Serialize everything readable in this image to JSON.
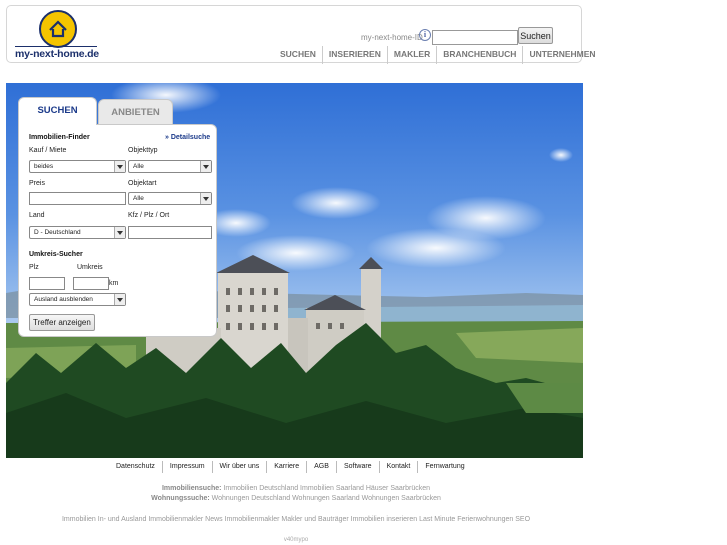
{
  "header": {
    "logo_text": "my-next-home.de",
    "id_label": "my-next-home-ID",
    "info_glyph": "i",
    "search_button": "Suchen",
    "nav": [
      "SUCHEN",
      "INSERIEREN",
      "MAKLER",
      "BRANCHENBUCH",
      "UNTERNEHMEN"
    ]
  },
  "panel": {
    "tabs": {
      "active": "SUCHEN",
      "inactive": "ANBIETEN"
    },
    "finder_title": "Immobilien-Finder",
    "detail_link": "» Detailsuche",
    "kauf_label": "Kauf / Miete",
    "kauf_value": "beides",
    "objekttyp_label": "Objekttyp",
    "objekttyp_value": "Alle",
    "preis_label": "Preis",
    "objektart_label": "Objektart",
    "objektart_value": "Alle",
    "land_label": "Land",
    "land_value": "D - Deutschland",
    "kfz_label": "Kfz / Plz / Ort",
    "umkreis_title": "Umkreis-Sucher",
    "plz_label": "Plz",
    "umkreis_label": "Umkreis",
    "km_label": "km",
    "ausland_value": "Ausland ausblenden",
    "submit_label": "Treffer anzeigen"
  },
  "footer": {
    "links": [
      "Datenschutz",
      "Impressum",
      "Wir über uns",
      "Karriere",
      "AGB",
      "Software",
      "Kontakt",
      "Fernwartung"
    ],
    "immo_label": "Immobiliensuche:",
    "immo_text": " Immobilien Deutschland Immobilien Saarland Häuser Saarbrücken",
    "wohn_label": "Wohnungssuche:",
    "wohn_text": " Wohnungen Deutschland Wohnungen Saarland Wohnungen Saarbrücken",
    "seo_line": "Immobilien In- und Ausland Immobilienmakler News Immobilienmakler Makler und Bauträger Immobilien inserieren Last Minute Ferienwohnungen SEO",
    "version": "v40mypo"
  },
  "colors": {
    "brand_blue": "#1b3a8a",
    "logo_yellow": "#f5c400"
  }
}
